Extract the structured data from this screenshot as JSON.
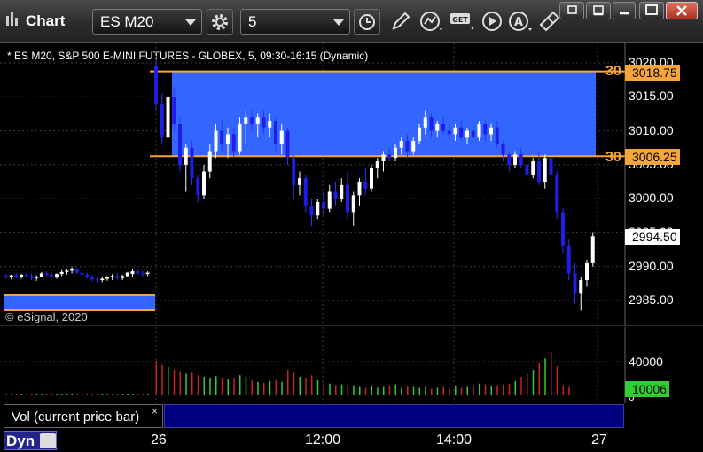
{
  "window": {
    "title": "Chart",
    "symbol": "ES M20",
    "interval": "5",
    "colors": {
      "up_candle": "#ffffff",
      "down_candle": "#1e1ee8",
      "zone_fill": "#3366ff",
      "level_line": "#f7a53a",
      "vol_up": "#32cd32",
      "vol_down": "#cc2222"
    }
  },
  "toolbar": {
    "buttons": [
      "settings-gear-icon",
      "clock-icon",
      "pencil-draw-icon",
      "study-icon",
      "get-data-icon",
      "play-icon",
      "alert-icon",
      "link-icon"
    ]
  },
  "chart": {
    "header": "* ES M20, S&P 500 E-MINI FUTURES - GLOBEX, 5, 09:30-16:15 (Dynamic)",
    "copyright": "© eSignal, 2020",
    "price_axis": [
      "3020.00",
      "3015.00",
      "3010.00",
      "3005.00",
      "3000.00",
      "2995.00",
      "2990.00",
      "2985.00"
    ],
    "levels": [
      {
        "label": "30",
        "price": "3018.75",
        "value": 3018.75
      },
      {
        "label": "30",
        "price": "3006.25",
        "value": 3006.25
      }
    ],
    "last_price": "2994.50",
    "vol_axis": [
      "40000",
      "0"
    ],
    "last_volume": "10006",
    "time_axis": [
      "26",
      "12:00",
      "14:00",
      "27"
    ]
  },
  "study": {
    "label": "Vol (current price bar)",
    "close": "×"
  },
  "bottom": {
    "mode": "Dyn"
  },
  "chart_data": {
    "type": "candlestick",
    "title": "ES M20, S&P 500 E-MINI FUTURES - GLOBEX, 5, 09:30-16:15 (Dynamic)",
    "ylim": [
      2983,
      3022
    ],
    "zone": [
      3006.25,
      3018.75
    ],
    "candles": [
      [
        2988.6,
        2988.9,
        2988.2,
        2988.4
      ],
      [
        2988.4,
        2988.8,
        2988.1,
        2988.7
      ],
      [
        2988.7,
        2989.0,
        2988.3,
        2988.5
      ],
      [
        2988.5,
        2988.9,
        2988.2,
        2988.8
      ],
      [
        2988.8,
        2989.1,
        2988.5,
        2988.6
      ],
      [
        2988.6,
        2989.0,
        2988.0,
        2988.3
      ],
      [
        2988.3,
        2988.7,
        2987.9,
        2988.5
      ],
      [
        2988.5,
        2989.2,
        2988.4,
        2989.0
      ],
      [
        2989.0,
        2989.3,
        2988.6,
        2988.8
      ],
      [
        2988.8,
        2989.1,
        2988.3,
        2988.5
      ],
      [
        2988.5,
        2989.0,
        2988.2,
        2988.9
      ],
      [
        2988.9,
        2989.5,
        2988.6,
        2989.2
      ],
      [
        2989.2,
        2989.6,
        2988.8,
        2989.4
      ],
      [
        2989.4,
        2989.9,
        2989.0,
        2989.6
      ],
      [
        2989.6,
        2989.8,
        2988.9,
        2989.1
      ],
      [
        2989.1,
        2989.4,
        2988.6,
        2988.8
      ],
      [
        2988.8,
        2989.1,
        2988.2,
        2988.4
      ],
      [
        2988.4,
        2988.8,
        2987.8,
        2988.1
      ],
      [
        2988.1,
        2988.5,
        2987.6,
        2988.0
      ],
      [
        2988.0,
        2988.4,
        2987.7,
        2988.2
      ],
      [
        2988.2,
        2988.6,
        2987.9,
        2988.4
      ],
      [
        2988.4,
        2988.9,
        2988.0,
        2988.6
      ],
      [
        2988.6,
        2989.0,
        2988.1,
        2988.3
      ],
      [
        2988.3,
        2988.8,
        2988.0,
        2988.6
      ],
      [
        2988.6,
        2989.2,
        2988.4,
        2989.1
      ],
      [
        2988.9,
        2989.6,
        2988.5,
        2989.3
      ],
      [
        2989.3,
        2989.7,
        2988.8,
        2989.0
      ],
      [
        2989.0,
        2989.4,
        2988.5,
        2988.9
      ],
      [
        2988.9,
        2989.3,
        2988.6,
        2989.1
      ],
      [
        3019.5,
        3020.5,
        3013.0,
        3014.0
      ],
      [
        3014.0,
        3015.5,
        3008.0,
        3009.0
      ],
      [
        3009.0,
        3016.0,
        3007.5,
        3015.0
      ],
      [
        3015.0,
        3016.5,
        3010.0,
        3011.0
      ],
      [
        3011.0,
        3012.0,
        3004.0,
        3005.0
      ],
      [
        3005.0,
        3008.0,
        3001.0,
        3007.5
      ],
      [
        3007.5,
        3008.5,
        3002.0,
        3003.0
      ],
      [
        3003.0,
        3003.5,
        2999.5,
        3000.5
      ],
      [
        3000.5,
        3005.0,
        3000.0,
        3004.0
      ],
      [
        3004.0,
        3008.0,
        3003.0,
        3007.0
      ],
      [
        3007.0,
        3011.0,
        3006.0,
        3010.0
      ],
      [
        3010.0,
        3011.5,
        3007.0,
        3008.0
      ],
      [
        3008.0,
        3010.5,
        3006.0,
        3009.5
      ],
      [
        3009.5,
        3010.5,
        3006.0,
        3007.0
      ],
      [
        3007.0,
        3012.0,
        3006.5,
        3011.0
      ],
      [
        3011.0,
        3013.0,
        3008.0,
        3012.0
      ],
      [
        3012.0,
        3013.0,
        3010.0,
        3011.0
      ],
      [
        3011.0,
        3012.5,
        3009.0,
        3012.0
      ],
      [
        3012.0,
        3013.0,
        3009.5,
        3010.5
      ],
      [
        3010.5,
        3012.5,
        3009.0,
        3011.5
      ],
      [
        3011.5,
        3012.0,
        3007.0,
        3008.0
      ],
      [
        3008.0,
        3011.0,
        3006.5,
        3010.0
      ],
      [
        3010.0,
        3010.5,
        3005.0,
        3006.0
      ],
      [
        3006.0,
        3006.5,
        3000.0,
        3002.0
      ],
      [
        3002.0,
        3004.0,
        3000.5,
        3003.0
      ],
      [
        3003.0,
        3003.5,
        2998.0,
        2999.0
      ],
      [
        2999.0,
        3000.0,
        2996.0,
        2997.5
      ],
      [
        2997.5,
        3000.0,
        2997.0,
        2999.5
      ],
      [
        2999.5,
        3001.0,
        2997.5,
        2998.5
      ],
      [
        2998.5,
        3002.0,
        2998.0,
        3001.0
      ],
      [
        3001.0,
        3002.5,
        2999.0,
        3000.0
      ],
      [
        3000.0,
        3003.0,
        2999.5,
        3002.0
      ],
      [
        3002.0,
        3004.0,
        2997.0,
        2998.0
      ],
      [
        2998.0,
        3001.0,
        2996.0,
        3000.5
      ],
      [
        3000.5,
        3003.0,
        2999.0,
        3002.5
      ],
      [
        3002.5,
        3004.5,
        3000.5,
        3001.5
      ],
      [
        3001.5,
        3005.0,
        3001.0,
        3004.5
      ],
      [
        3004.5,
        3006.0,
        3003.0,
        3005.5
      ],
      [
        3005.5,
        3007.0,
        3004.0,
        3006.5
      ],
      [
        3006.5,
        3007.5,
        3005.5,
        3006.0
      ],
      [
        3006.0,
        3008.0,
        3005.5,
        3007.5
      ],
      [
        3007.5,
        3009.0,
        3006.5,
        3008.5
      ],
      [
        3008.5,
        3009.5,
        3006.0,
        3007.0
      ],
      [
        3007.0,
        3009.0,
        3006.5,
        3008.5
      ],
      [
        3008.5,
        3011.0,
        3008.0,
        3010.5
      ],
      [
        3010.5,
        3013.0,
        3009.5,
        3012.0
      ],
      [
        3012.0,
        3012.5,
        3009.0,
        3010.0
      ],
      [
        3010.0,
        3011.5,
        3009.0,
        3011.0
      ],
      [
        3011.0,
        3012.0,
        3009.5,
        3010.0
      ],
      [
        3010.0,
        3011.0,
        3008.5,
        3009.5
      ],
      [
        3009.5,
        3011.0,
        3008.5,
        3010.5
      ],
      [
        3010.5,
        3011.5,
        3008.5,
        3009.0
      ],
      [
        3009.0,
        3010.5,
        3008.0,
        3010.0
      ],
      [
        3010.0,
        3011.0,
        3008.0,
        3009.0
      ],
      [
        3009.0,
        3011.5,
        3008.5,
        3011.0
      ],
      [
        3011.0,
        3011.5,
        3008.5,
        3009.5
      ],
      [
        3009.5,
        3011.0,
        3008.5,
        3010.5
      ],
      [
        3010.5,
        3011.5,
        3007.5,
        3008.0
      ],
      [
        3008.0,
        3008.5,
        3005.5,
        3006.5
      ],
      [
        3006.5,
        3007.0,
        3004.0,
        3005.0
      ],
      [
        3005.0,
        3007.0,
        3004.5,
        3006.5
      ],
      [
        3006.5,
        3007.5,
        3004.5,
        3005.0
      ],
      [
        3005.0,
        3006.5,
        3003.0,
        3003.5
      ],
      [
        3003.5,
        3006.0,
        3003.0,
        3005.5
      ],
      [
        3005.5,
        3007.0,
        3002.0,
        3002.5
      ],
      [
        3002.5,
        3006.5,
        3001.5,
        3006.0
      ],
      [
        3006.0,
        3007.0,
        3003.0,
        3003.5
      ],
      [
        3003.5,
        3004.0,
        2997.0,
        2998.0
      ],
      [
        2998.0,
        2998.5,
        2992.0,
        2993.0
      ],
      [
        2993.0,
        2994.0,
        2988.0,
        2989.0
      ],
      [
        2989.0,
        2990.5,
        2984.5,
        2986.0
      ],
      [
        2986.0,
        2988.5,
        2983.5,
        2988.0
      ],
      [
        2988.0,
        2991.0,
        2987.0,
        2990.5
      ],
      [
        2990.5,
        2995.0,
        2990.0,
        2994.5
      ]
    ],
    "volume_ylim": [
      0,
      50000
    ],
    "volume": [
      800,
      600,
      700,
      500,
      600,
      900,
      700,
      800,
      600,
      500,
      700,
      900,
      800,
      600,
      700,
      800,
      900,
      600,
      700,
      800,
      600,
      700,
      500,
      600,
      900,
      800,
      700,
      600,
      800,
      41000,
      36000,
      34000,
      30000,
      28000,
      26000,
      27000,
      24000,
      22000,
      20000,
      23000,
      21000,
      19000,
      20000,
      24000,
      22000,
      18000,
      16000,
      15000,
      17000,
      18000,
      16000,
      30000,
      27000,
      22000,
      20000,
      24000,
      18000,
      16000,
      14000,
      12000,
      13000,
      11000,
      12000,
      10000,
      9000,
      11000,
      9000,
      10000,
      12000,
      13000,
      9000,
      11000,
      10000,
      9000,
      10000,
      8000,
      9000,
      10000,
      8000,
      11000,
      9000,
      10000,
      12000,
      14000,
      13000,
      11000,
      12000,
      13000,
      14000,
      17000,
      22000,
      26000,
      30000,
      38000,
      44000,
      52000,
      35000,
      12000,
      10006
    ],
    "x_ticks": [
      "26",
      "12:00",
      "14:00",
      "27"
    ]
  }
}
